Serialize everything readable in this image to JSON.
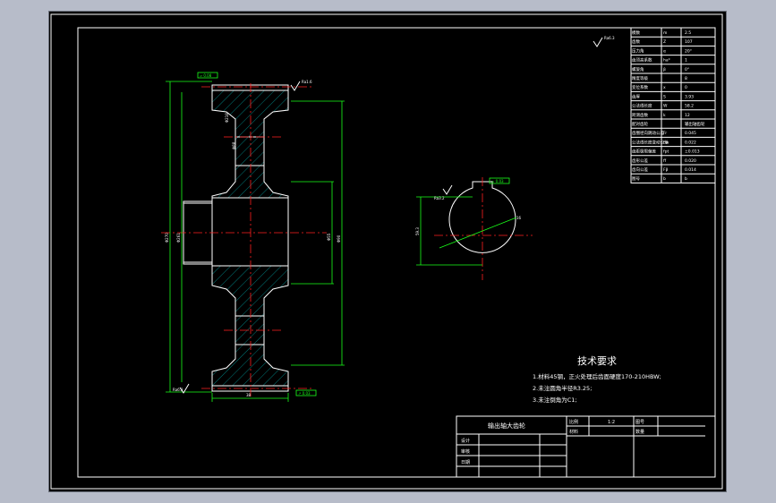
{
  "drawing": {
    "tech_title": "技术要求",
    "tech_notes": [
      "1.材料45钢，正火处理后齿面硬度170-210HBW;",
      "2.未注圆角半径R3.25;",
      "3.未注倒角为C1;"
    ],
    "part_name": "输出轴大齿轮",
    "title_block": {
      "scale_label": "比例",
      "scale_value": "1:2",
      "drawing_no_label": "图号",
      "qty_label": "数量",
      "material_label": "材料",
      "designer_label": "设计",
      "checker_label": "审核",
      "date_label": "日期"
    },
    "param_table": [
      [
        "模数",
        "m",
        "2.5"
      ],
      [
        "齿数",
        "Z",
        "107"
      ],
      [
        "压力角",
        "α",
        "20°"
      ],
      [
        "齿顶高系数",
        "ha*",
        "1"
      ],
      [
        "螺旋角",
        "β",
        "0°"
      ],
      [
        "精度等级",
        "",
        "8"
      ],
      [
        "变位系数",
        "x",
        "0"
      ],
      [
        "齿厚",
        "S",
        "3.93"
      ],
      [
        "公法线长度",
        "W",
        "58.2"
      ],
      [
        "跨测齿数",
        "k",
        "12"
      ],
      [
        "配对齿轮",
        "",
        "输出轴齿轮"
      ],
      [
        "齿圈径向跳动公差",
        "Fr",
        "0.045"
      ],
      [
        "公法线长度变动公差",
        "Fw",
        "0.022"
      ],
      [
        "齿距极限偏差",
        "fpt",
        "±0.013"
      ],
      [
        "齿形公差",
        "ff",
        "0.020"
      ],
      [
        "齿向公差",
        "Fβ",
        "0.014"
      ],
      [
        "图号",
        "b",
        "b"
      ]
    ],
    "callouts": {
      "flatness_box": "▱ 0.08",
      "runout_box": "↗ 0.03",
      "key_tol_box": "= 0.03",
      "roughness_mark": "Ra3.2",
      "roughness_main": "Ra1.6",
      "roughness_side": "Ra6.3",
      "dim_outer": "Φ270",
      "dim_hub": "Φ90",
      "dim_bore": "Φ55",
      "dim_root": "Φ261",
      "dim_web": "Φ218",
      "dim_hub_outer": "Φ88",
      "dim_width": "38",
      "dim_keyway": "59.3",
      "dim_key": "16",
      "dim_chamfer": "R3"
    }
  }
}
